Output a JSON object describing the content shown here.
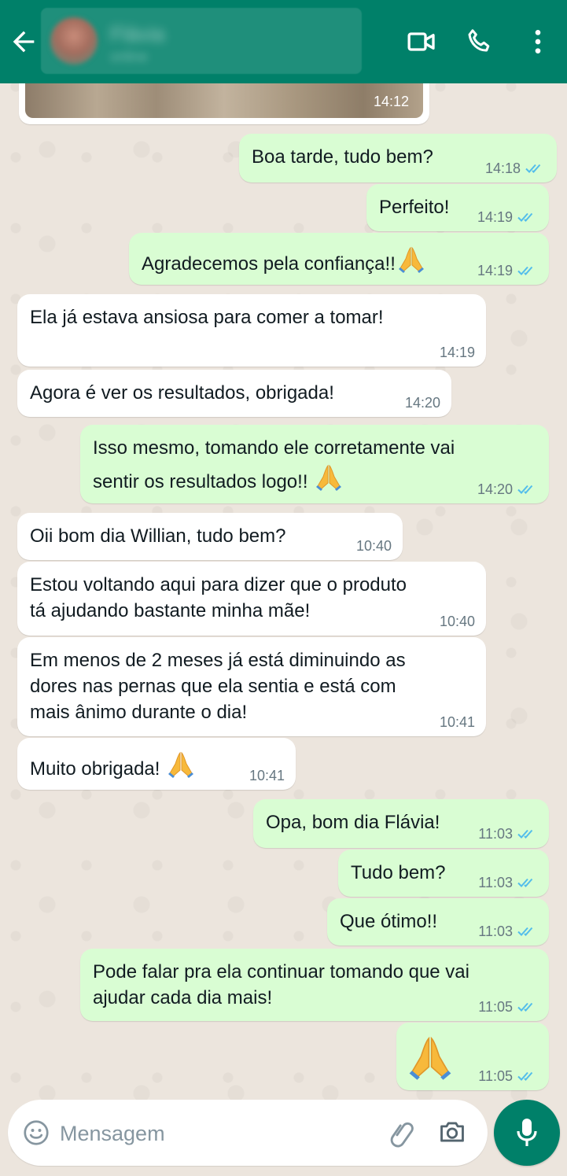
{
  "colors": {
    "header": "#008069",
    "outgoing_bubble": "#d9fdd3",
    "incoming_bubble": "#ffffff",
    "read_ticks": "#53bdeb",
    "timestamp": "#667781",
    "chat_background": "#efeae2"
  },
  "header": {
    "back_icon": "arrow-left-icon",
    "contact_name": "Flávia",
    "contact_status": "online",
    "video_icon": "video-call-icon",
    "call_icon": "phone-icon",
    "menu_icon": "more-vert-icon"
  },
  "image_message": {
    "time": "14:12"
  },
  "messages": [
    {
      "direction": "out",
      "lines": [
        "Boa tarde, tudo bem?"
      ],
      "time": "14:18",
      "status": "read"
    },
    {
      "direction": "out",
      "lines": [
        "Perfeito!"
      ],
      "time": "14:19",
      "status": "read"
    },
    {
      "direction": "out",
      "lines": [
        "Agradecemos pela confiança!!"
      ],
      "emoji": "praying-hands",
      "time": "14:19",
      "status": "read"
    },
    {
      "direction": "in",
      "lines": [
        "Ela já estava ansiosa para comer a tomar!"
      ],
      "time": "14:19"
    },
    {
      "direction": "in",
      "lines": [
        "Agora é ver os resultados, obrigada!"
      ],
      "time": "14:20"
    },
    {
      "direction": "out",
      "lines": [
        "Isso mesmo, tomando ele corretamente vai",
        "sentir os resultados logo!!"
      ],
      "emoji": "praying-hands",
      "time": "14:20",
      "status": "read"
    },
    {
      "direction": "in",
      "lines": [
        "Oii bom dia Willian, tudo bem?"
      ],
      "time": "10:40"
    },
    {
      "direction": "in",
      "lines": [
        "Estou voltando aqui para dizer que o produto",
        "tá ajudando bastante minha mãe!"
      ],
      "time": "10:40"
    },
    {
      "direction": "in",
      "lines": [
        "Em menos de 2 meses já está diminuindo as",
        "dores nas pernas que ela sentia e está com",
        "mais ânimo durante o dia!"
      ],
      "time": "10:41"
    },
    {
      "direction": "in",
      "lines": [
        "Muito obrigada!"
      ],
      "emoji": "praying-hands",
      "time": "10:41"
    },
    {
      "direction": "out",
      "lines": [
        "Opa, bom dia Flávia!"
      ],
      "time": "11:03",
      "status": "read"
    },
    {
      "direction": "out",
      "lines": [
        "Tudo bem?"
      ],
      "time": "11:03",
      "status": "read"
    },
    {
      "direction": "out",
      "lines": [
        "Que ótimo!!"
      ],
      "time": "11:03",
      "status": "read"
    },
    {
      "direction": "out",
      "lines": [
        "Pode falar pra ela continuar tomando que vai",
        "ajudar cada dia mais!"
      ],
      "time": "11:05",
      "status": "read"
    },
    {
      "direction": "out",
      "lines": [],
      "emoji": "praying-hands",
      "time": "11:05",
      "status": "read"
    }
  ],
  "input_bar": {
    "placeholder": "Mensagem",
    "emoji_icon": "emoji-icon",
    "attach_icon": "paperclip-icon",
    "camera_icon": "camera-icon",
    "mic_icon": "microphone-icon"
  }
}
